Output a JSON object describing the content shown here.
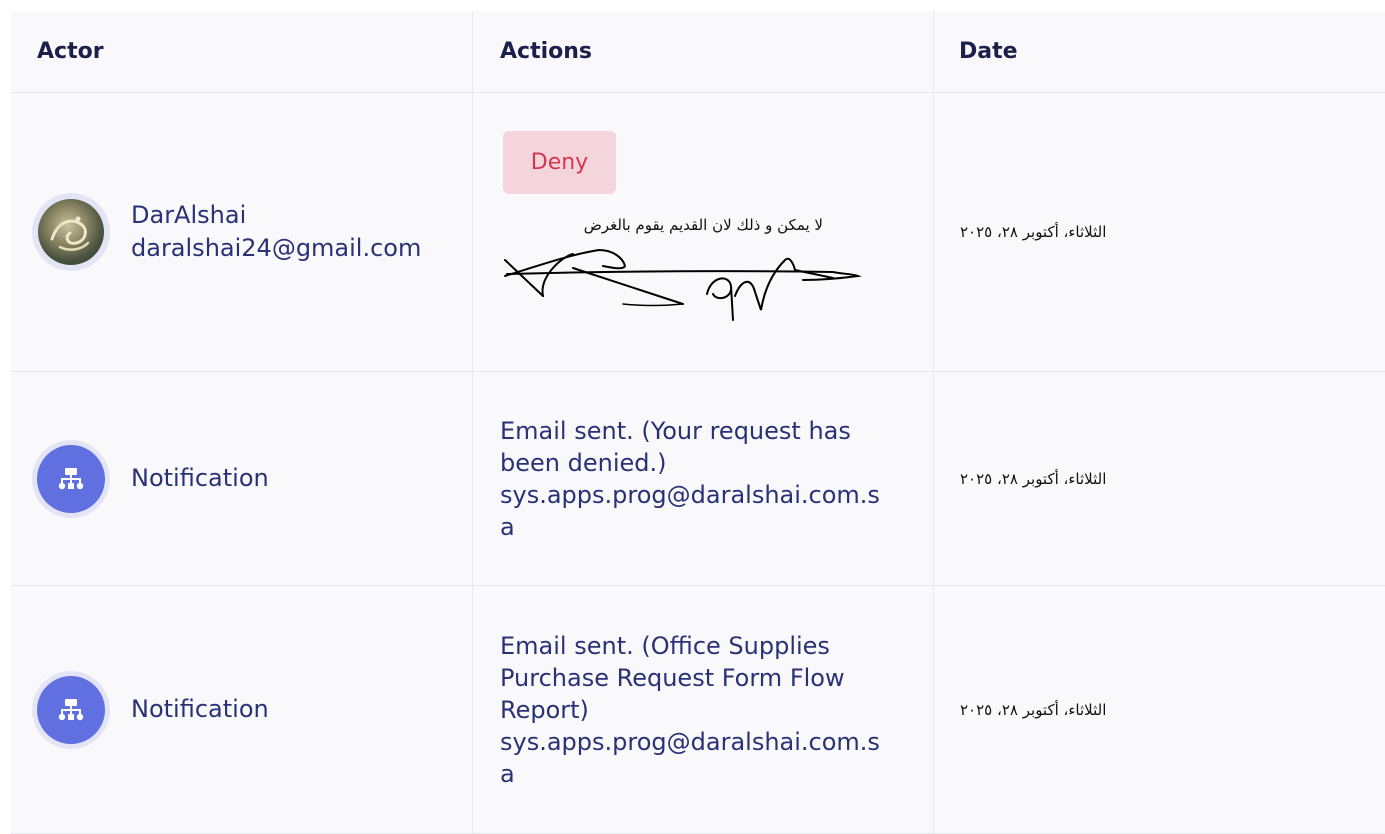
{
  "table": {
    "headers": {
      "actor": "Actor",
      "actions": "Actions",
      "date": "Date"
    },
    "rows": [
      {
        "actor_name": "DarAlshai",
        "actor_email": "daralshai24@gmail.com",
        "avatar_type": "user-photo",
        "status_badge": "Deny",
        "comment": "لا يمكن و ذلك لان القديم يقوم بالغرض",
        "date": "الثلاثاء، أكتوبر ٢٨، ٢٠٢٥"
      },
      {
        "actor_name": "Notification",
        "avatar_type": "sitemap-icon",
        "action_text": "Email sent. (Your request has been denied.) sys.apps.prog@daralshai.com.sa",
        "date": "الثلاثاء، أكتوبر ٢٨، ٢٠٢٥"
      },
      {
        "actor_name": "Notification",
        "avatar_type": "sitemap-icon",
        "action_text": "Email sent. (Office Supplies Purchase Request Form Flow Report) sys.apps.prog@daralshai.com.sa",
        "date": "الثلاثاء، أكتوبر ٢٨، ٢٠٢٥"
      }
    ]
  },
  "colors": {
    "header_text": "#1c1f4a",
    "body_text": "#2a3176",
    "deny_bg": "#f3d5db",
    "deny_text": "#d4374f",
    "notification_avatar": "#6170e0"
  }
}
